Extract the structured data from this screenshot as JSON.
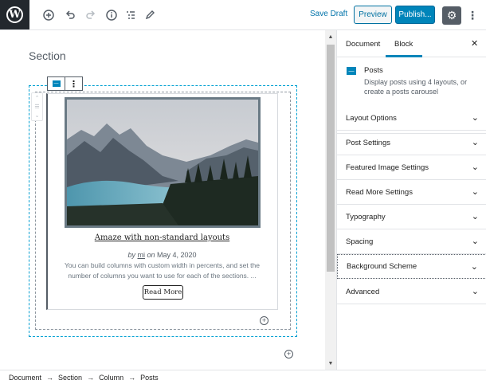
{
  "toolbar": {
    "logo_letter": "W",
    "save_draft": "Save Draft",
    "preview": "Preview",
    "publish": "Publish...",
    "icons": [
      "add-block-icon",
      "undo-icon",
      "redo-icon",
      "info-icon",
      "outline-icon",
      "tools-icon",
      "gear-icon",
      "more-vertical-icon"
    ]
  },
  "editor": {
    "section_title": "Section",
    "post": {
      "title": "Amaze with non-standard layouts",
      "by": "by",
      "author": "mi",
      "on": "on",
      "date": "May 4, 2020",
      "excerpt": "You can build columns with custom width in percents, and set the number of columns you want to use for each of the sections. ...",
      "read_more": "Read More"
    }
  },
  "sidebar": {
    "tabs": [
      "Document",
      "Block"
    ],
    "active_tab": "Block",
    "close_glyph": "✕",
    "block": {
      "title": "Posts",
      "description": "Display posts using 4 layouts, or create a posts carousel"
    },
    "panels": [
      {
        "label": "Layout Options"
      },
      {
        "label": "Post Settings"
      },
      {
        "label": "Featured Image Settings"
      },
      {
        "label": "Read More Settings"
      },
      {
        "label": "Typography"
      },
      {
        "label": "Spacing"
      },
      {
        "label": "Background Scheme"
      },
      {
        "label": "Advanced"
      }
    ]
  },
  "breadcrumb": {
    "items": [
      "Document",
      "Section",
      "Column",
      "Posts"
    ],
    "separator": "→"
  },
  "colors": {
    "accent": "#0085ba",
    "dark": "#23282d",
    "section_border": "#00a0d2"
  }
}
